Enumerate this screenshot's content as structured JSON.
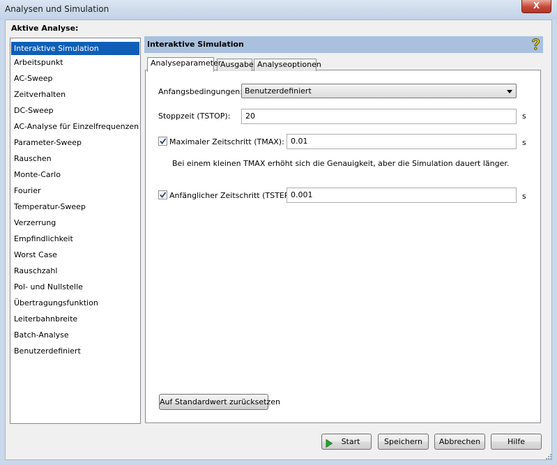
{
  "window": {
    "title": "Analysen und Simulation",
    "close_symbol": "X"
  },
  "analysis": {
    "group_label": "Aktive Analyse:",
    "items": [
      {
        "label": "Interaktive Simulation",
        "selected": true
      },
      {
        "label": "Arbeitspunkt"
      },
      {
        "label": "AC-Sweep"
      },
      {
        "label": "Zeitverhalten"
      },
      {
        "label": "DC-Sweep"
      },
      {
        "label": "AC-Analyse für Einzelfrequenzen"
      },
      {
        "label": "Parameter-Sweep"
      },
      {
        "label": "Rauschen"
      },
      {
        "label": "Monte-Carlo"
      },
      {
        "label": "Fourier"
      },
      {
        "label": "Temperatur-Sweep"
      },
      {
        "label": "Verzerrung"
      },
      {
        "label": "Empfindlichkeit"
      },
      {
        "label": "Worst Case"
      },
      {
        "label": "Rauschzahl"
      },
      {
        "label": "Pol- und Nullstelle"
      },
      {
        "label": "Übertragungsfunktion"
      },
      {
        "label": "Leiterbahnbreite"
      },
      {
        "label": "Batch-Analyse"
      },
      {
        "label": "Benutzerdefiniert"
      }
    ]
  },
  "panel": {
    "title": "Interaktive Simulation",
    "help_icon": "help-question-icon",
    "tabs": [
      {
        "label": "Analyseparameter",
        "active": true
      },
      {
        "label": "Ausgabe"
      },
      {
        "label": "Analyseoptionen"
      }
    ],
    "initial_conditions": {
      "label": "Anfangsbedingungen:",
      "selected": "Benutzerdefiniert"
    },
    "stop_time": {
      "label": "Stoppzeit (TSTOP):",
      "value": "20",
      "unit": "s"
    },
    "max_step": {
      "label": "Maximaler Zeitschritt (TMAX):",
      "checked": true,
      "value": "0.01",
      "unit": "s"
    },
    "hint": "Bei einem kleinen TMAX erhöht sich die Genauigkeit, aber die Simulation dauert länger.",
    "initial_step": {
      "label": "Anfänglicher Zeitschritt (TSTEP):",
      "checked": true,
      "value": "0.001",
      "unit": "s"
    },
    "reset_button": "Auf Standardwert zurücksetzen"
  },
  "buttons": {
    "start": "Start",
    "save": "Speichern",
    "cancel": "Abbrechen",
    "help": "Hilfe"
  },
  "colors": {
    "selection": "#0f5fb8",
    "header": "#a9c1de",
    "start_arrow": "#2aa52a"
  }
}
